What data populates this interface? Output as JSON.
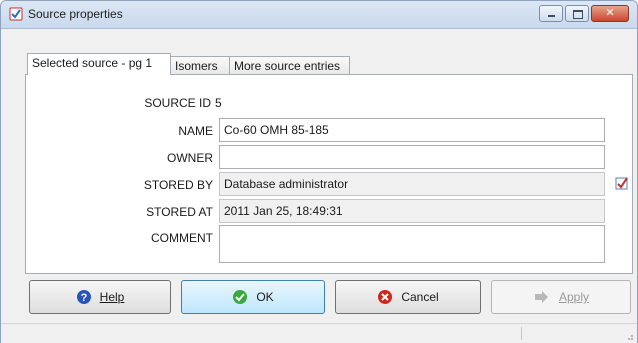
{
  "window": {
    "title": "Source properties",
    "controls": {
      "minimize": "minimize",
      "maximize": "maximize",
      "close": "close"
    }
  },
  "tabs": [
    {
      "label": "Selected source - pg 1",
      "active": true
    },
    {
      "label": "Isomers",
      "active": false
    },
    {
      "label": "More source entries",
      "active": false
    }
  ],
  "form": {
    "source_id": {
      "label": "SOURCE ID",
      "value": "5"
    },
    "name": {
      "label": "NAME",
      "value": "Co-60 OMH 85-185"
    },
    "owner": {
      "label": "OWNER",
      "value": ""
    },
    "stored_by": {
      "label": "STORED BY",
      "value": "Database administrator"
    },
    "stored_at": {
      "label": "STORED AT",
      "value": "2011 Jan 25, 18:49:31"
    },
    "comment": {
      "label": "COMMENT",
      "value": ""
    }
  },
  "buttons": {
    "help": "Help",
    "ok": "OK",
    "cancel": "Cancel",
    "apply": "Apply"
  },
  "colors": {
    "titlebar": "#c9d9ec",
    "ok_icon": "#3aa83a",
    "cancel_icon": "#d0261d",
    "help_icon": "#2a55b8"
  },
  "icons": {
    "app": "checklist-icon",
    "help": "question-icon",
    "ok": "checkmark-icon",
    "cancel": "x-circle-icon",
    "apply": "arrow-apply-icon",
    "edit": "edit-note-icon"
  }
}
